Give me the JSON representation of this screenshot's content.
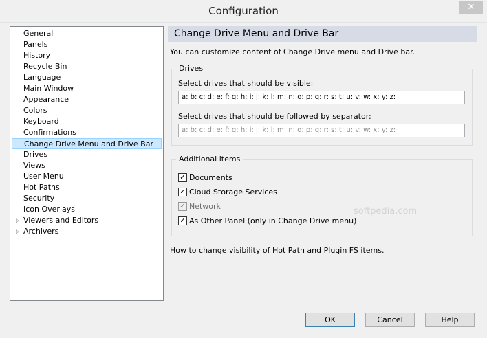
{
  "window": {
    "title": "Configuration",
    "close_glyph": "✕"
  },
  "tree": {
    "items": [
      {
        "label": "General",
        "arrow": ""
      },
      {
        "label": "Panels",
        "arrow": ""
      },
      {
        "label": "History",
        "arrow": ""
      },
      {
        "label": "Recycle Bin",
        "arrow": ""
      },
      {
        "label": "Language",
        "arrow": ""
      },
      {
        "label": "Main Window",
        "arrow": ""
      },
      {
        "label": "Appearance",
        "arrow": ""
      },
      {
        "label": "Colors",
        "arrow": ""
      },
      {
        "label": "Keyboard",
        "arrow": ""
      },
      {
        "label": "Confirmations",
        "arrow": ""
      },
      {
        "label": "Change Drive Menu and Drive Bar",
        "arrow": "",
        "selected": true
      },
      {
        "label": "Drives",
        "arrow": ""
      },
      {
        "label": "Views",
        "arrow": ""
      },
      {
        "label": "User Menu",
        "arrow": ""
      },
      {
        "label": "Hot Paths",
        "arrow": ""
      },
      {
        "label": "Security",
        "arrow": ""
      },
      {
        "label": "Icon Overlays",
        "arrow": ""
      },
      {
        "label": "Viewers and Editors",
        "arrow": "▷"
      },
      {
        "label": "Archivers",
        "arrow": "▷"
      }
    ]
  },
  "panel": {
    "header": "Change Drive Menu and Drive Bar",
    "description": "You can customize content of Change Drive menu and Drive bar.",
    "drives_group": {
      "caption": "Drives",
      "visible_label": "Select drives that should be visible:",
      "visible_value": "a: b: c: d: e: f: g: h: i: j: k: l: m: n: o: p: q: r: s: t: u: v: w: x: y: z:",
      "separator_label": "Select drives that should be followed by separator:",
      "separator_value": "a: b: c: d: e: f: g: h: i: j: k: l: m: n: o: p: q: r: s: t: u: v: w: x: y: z:"
    },
    "additional_group": {
      "caption": "Additional items",
      "items": [
        {
          "label": "Documents",
          "checked": true,
          "disabled": false
        },
        {
          "label": "Cloud Storage Services",
          "checked": true,
          "disabled": false
        },
        {
          "label": "Network",
          "checked": true,
          "disabled": true
        },
        {
          "label": "As Other Panel (only in Change Drive menu)",
          "checked": true,
          "disabled": false
        }
      ],
      "check_glyph": "✓"
    },
    "bottom": {
      "prefix": "How to change visibility of ",
      "link1": "Hot Path",
      "middle": " and ",
      "link2": "Plugin FS",
      "suffix": " items."
    },
    "watermark": "softpedia.com"
  },
  "buttons": {
    "ok": "OK",
    "cancel": "Cancel",
    "help": "Help"
  }
}
